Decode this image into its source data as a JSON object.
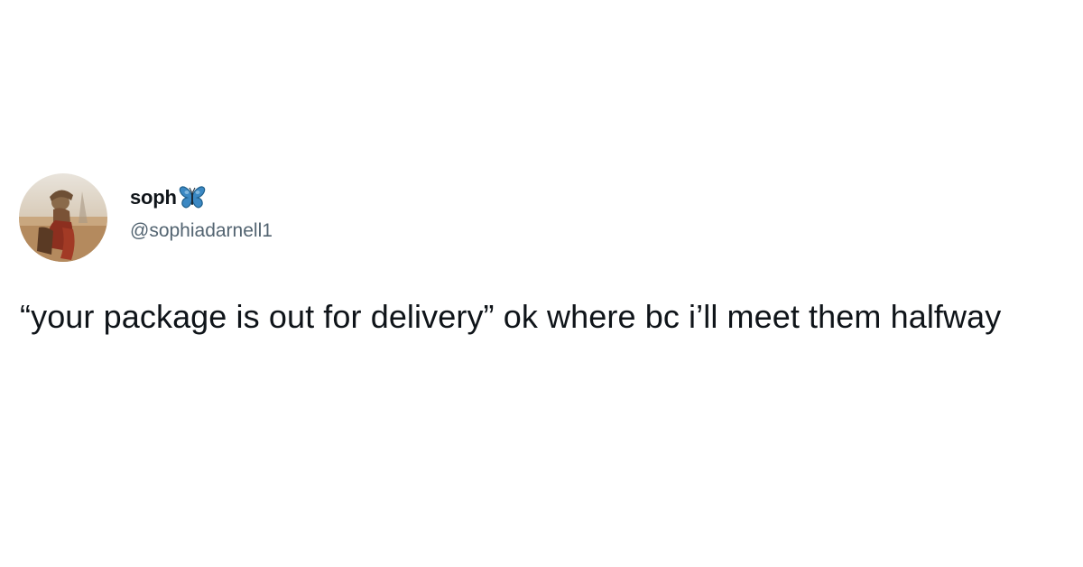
{
  "tweet": {
    "display_name": "soph",
    "handle": "@sophiadarnell1",
    "text": "“your package is out for delivery” ok where bc i’ll meet them halfway"
  },
  "icons": {
    "name_emoji": "butterfly-icon"
  },
  "colors": {
    "text_primary": "#0f1419",
    "text_secondary": "#536471",
    "butterfly_blue": "#3b88c3",
    "background": "#ffffff"
  }
}
